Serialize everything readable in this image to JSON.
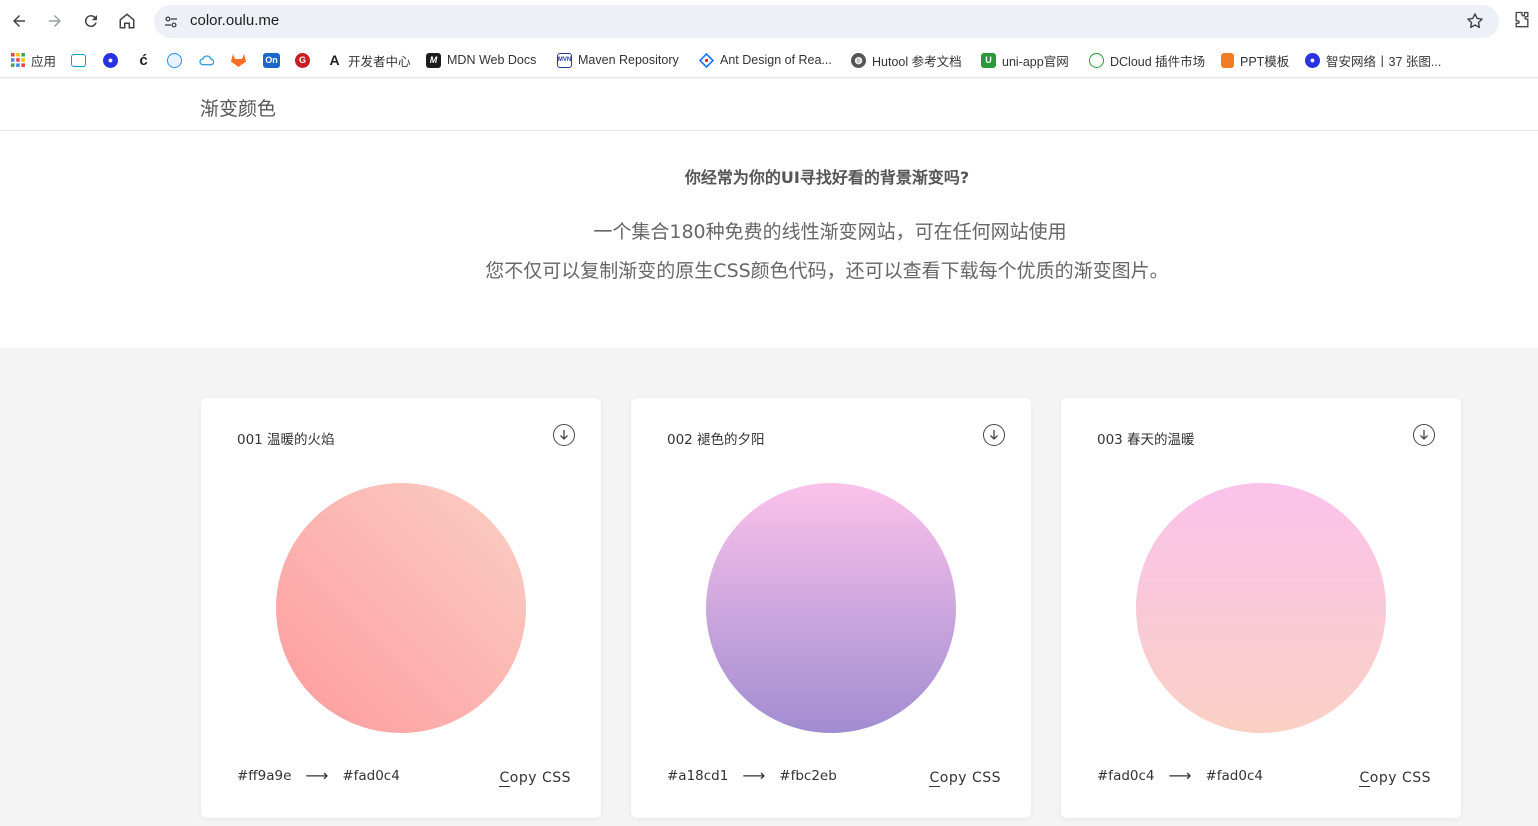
{
  "browser": {
    "url": "color.oulu.me",
    "bookmarks": [
      {
        "label": "应用",
        "icon": "apps-grid-icon",
        "color": "#4285f4"
      },
      {
        "label": "",
        "icon": "bilibili-icon",
        "color": "#00a1d6"
      },
      {
        "label": "",
        "icon": "baidu-paw-icon",
        "color": "#2932e1"
      },
      {
        "label": "",
        "icon": "juejin-icon",
        "color": "#f58f00"
      },
      {
        "label": "",
        "icon": "blue-logo-icon",
        "color": "#1e90ff"
      },
      {
        "label": "",
        "icon": "cloud-icon",
        "color": "#3c9ddc"
      },
      {
        "label": "",
        "icon": "gitlab-fox-icon",
        "color": "#fc6d26"
      },
      {
        "label": "",
        "icon": "on-icon",
        "color": "#1a66c9"
      },
      {
        "label": "",
        "icon": "gitee-icon",
        "color": "#c71d23"
      },
      {
        "label": "开发者中心",
        "icon": "developer-a-icon",
        "color": "#222222"
      },
      {
        "label": "MDN Web Docs",
        "icon": "mdn-icon",
        "color": "#1b1b1b"
      },
      {
        "label": "Maven Repository",
        "icon": "maven-icon",
        "color": "#23408e"
      },
      {
        "label": "Ant Design of Rea...",
        "icon": "ant-design-icon",
        "color": "#1677ff"
      },
      {
        "label": "Hutool 参考文档",
        "icon": "globe-icon",
        "color": "#555555"
      },
      {
        "label": "uni-app官网",
        "icon": "uniapp-icon",
        "color": "#2b9939"
      },
      {
        "label": "DCloud 插件市场",
        "icon": "dcloud-icon",
        "color": "#2b9939"
      },
      {
        "label": "PPT模板",
        "icon": "ppt-icon",
        "color": "#f07c25"
      },
      {
        "label": "智安网络丨37 张图...",
        "icon": "baidu-paw-icon",
        "color": "#2932e1"
      }
    ]
  },
  "site": {
    "title": "渐变颜色",
    "question": "你经常为你的UI寻找好看的背景渐变吗?",
    "line1": "一个集合180种免费的线性渐变网站，可在任何网站使用",
    "line2": "您不仅可以复制渐变的原生CSS颜色代码，还可以查看下载每个优质的渐变图片。"
  },
  "cards": [
    {
      "title": "001 温暖的火焰",
      "from": "#ff9a9e",
      "to": "#fad0c4",
      "copy_first": "C",
      "copy_rest": "opy CSS",
      "angle": "to top right"
    },
    {
      "title": "002 褪色的夕阳",
      "from": "#a18cd1",
      "to": "#fbc2eb",
      "copy_first": "C",
      "copy_rest": "opy CSS",
      "angle": "to top"
    },
    {
      "title": "003 春天的温暖",
      "from": "#fad0c4",
      "to": "#fad0c4",
      "copy_first": "C",
      "copy_rest": "opy CSS",
      "angle": "to top",
      "gradient_stops": [
        "#fad0c4",
        "#fbc2eb"
      ]
    }
  ],
  "arrow": "⟶"
}
